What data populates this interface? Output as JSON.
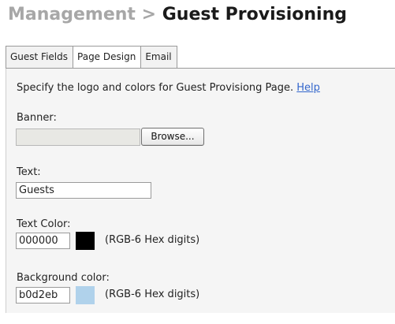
{
  "header": {
    "breadcrumb_parent": "Management",
    "separator": ">",
    "title": "Guest Provisioning"
  },
  "tabs": [
    {
      "label": "Guest Fields",
      "active": false
    },
    {
      "label": "Page Design",
      "active": true
    },
    {
      "label": "Email",
      "active": false
    }
  ],
  "page_design": {
    "description": "Specify the logo and colors for Guest Provisiong Page.",
    "help_link": "Help",
    "banner": {
      "label": "Banner:",
      "value": "",
      "browse_label": "Browse..."
    },
    "text": {
      "label": "Text:",
      "value": "Guests"
    },
    "text_color": {
      "label": "Text Color:",
      "value": "000000",
      "swatch": "#000000",
      "hint": "(RGB-6 Hex digits)"
    },
    "background_color": {
      "label": "Background color:",
      "value": "b0d2eb",
      "swatch": "#b0d2eb",
      "hint": "(RGB-6 Hex digits)"
    }
  }
}
